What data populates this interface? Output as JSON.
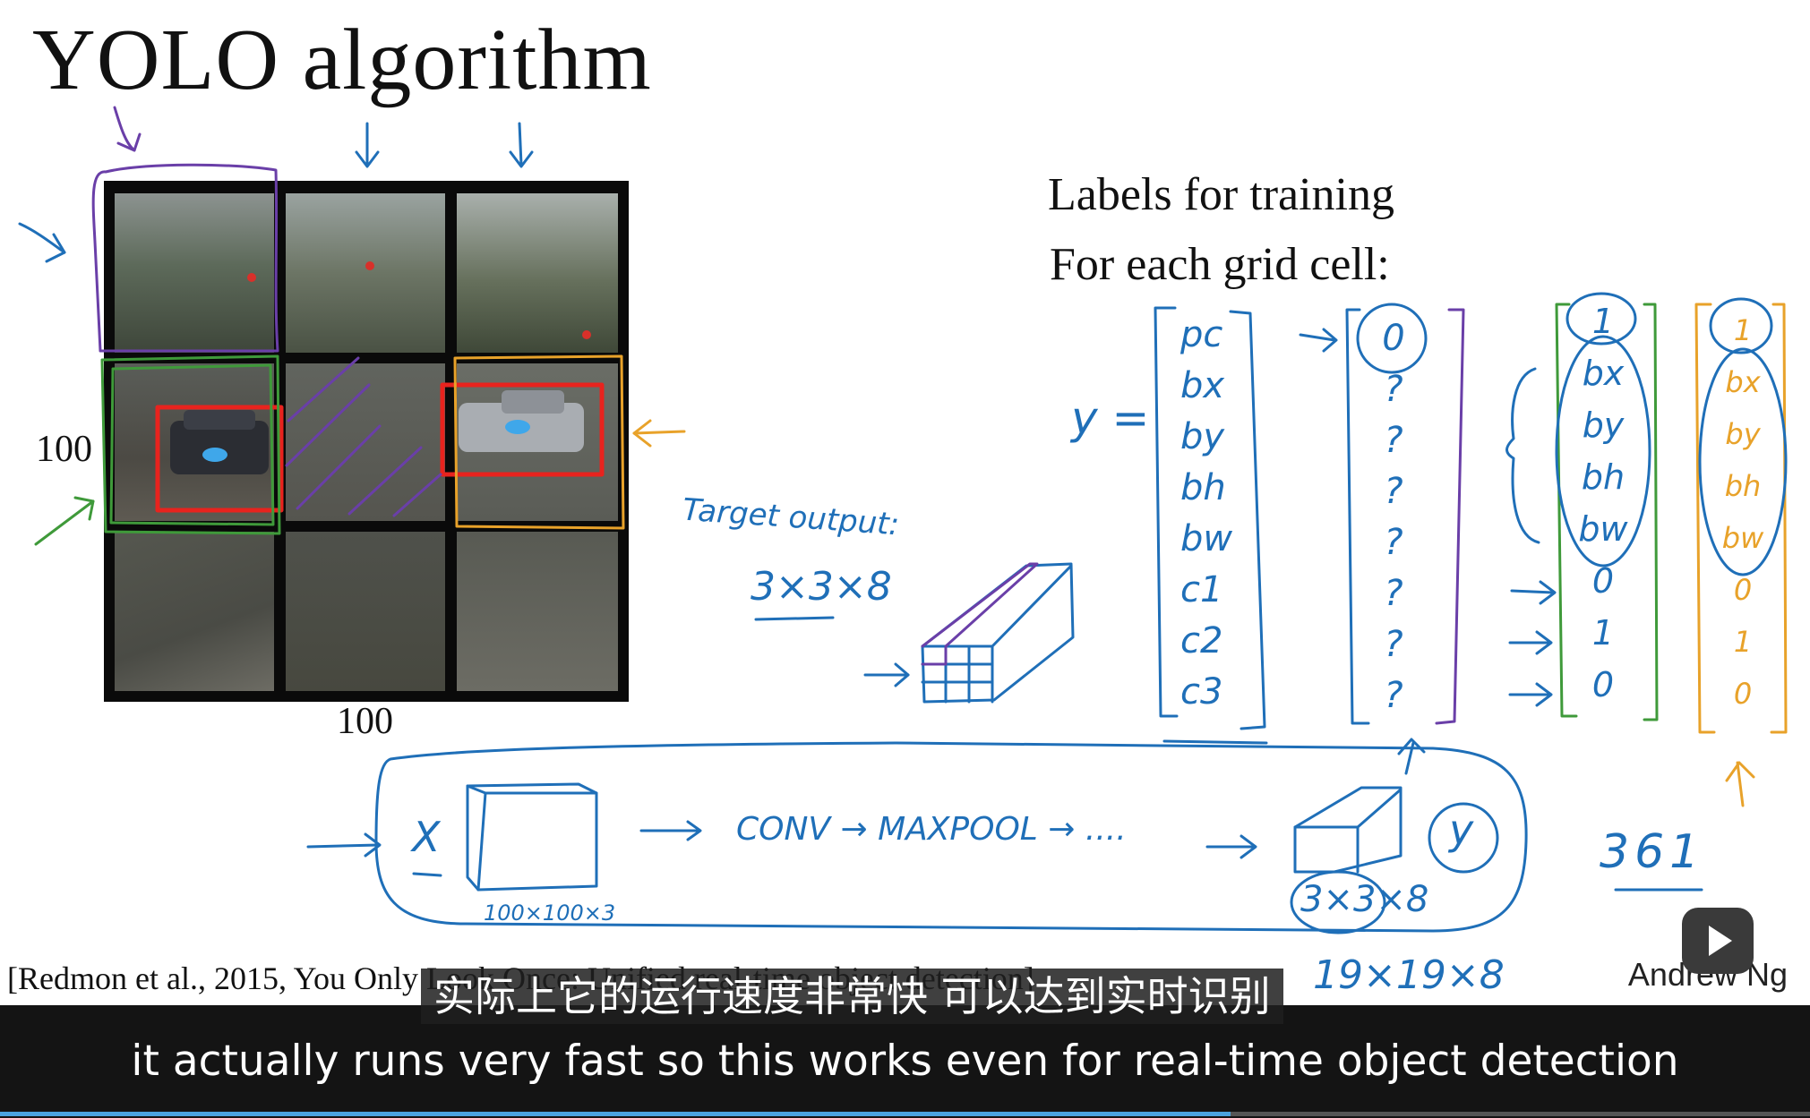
{
  "slide": {
    "title": "YOLO algorithm",
    "labels_heading": "Labels for training",
    "labels_subheading": "For each grid cell:",
    "dim_height": "100",
    "dim_width": "100",
    "citation": "[Redmon et al., 2015, You Only Look Once: Unified real-time object detection]",
    "author": "Andrew Ng"
  },
  "annotations": {
    "target_output": "Target output:",
    "target_shape": "3×3×8",
    "y_eq": "y =",
    "label_vector": [
      "pc",
      "bx",
      "by",
      "bh",
      "bw",
      "c1",
      "c2",
      "c3"
    ],
    "empty_cell_vector": [
      "0",
      "?",
      "?",
      "?",
      "?",
      "?",
      "?",
      "?"
    ],
    "car_cell_green": [
      "1",
      "bx",
      "by",
      "bh",
      "bw",
      "0",
      "1",
      "0"
    ],
    "car_cell_orange": [
      "1",
      "bx",
      "by",
      "bh",
      "bw",
      "0",
      "1",
      "0"
    ],
    "pipeline_input": "X",
    "pipeline_input_size": "100×100×3",
    "pipeline_steps": "CONV → MAXPOOL → ....",
    "pipeline_output": "y",
    "pipeline_output_shape": "3×3×8",
    "alt_shape": "19×19×8",
    "grid_count": "361"
  },
  "player": {
    "subtitle_cn": "实际上它的运行速度非常快 可以达到实时识别",
    "subtitle_en": "it actually runs very fast so this works even for real-time object detection",
    "progress_percent": 68,
    "play_button_icon": "play-icon"
  },
  "colors": {
    "ink_blue": "#1f6fb8",
    "ink_purple": "#6a3fa8",
    "ink_green": "#3f9a3a",
    "ink_orange": "#e8a22a",
    "box_red": "#e8231e"
  }
}
